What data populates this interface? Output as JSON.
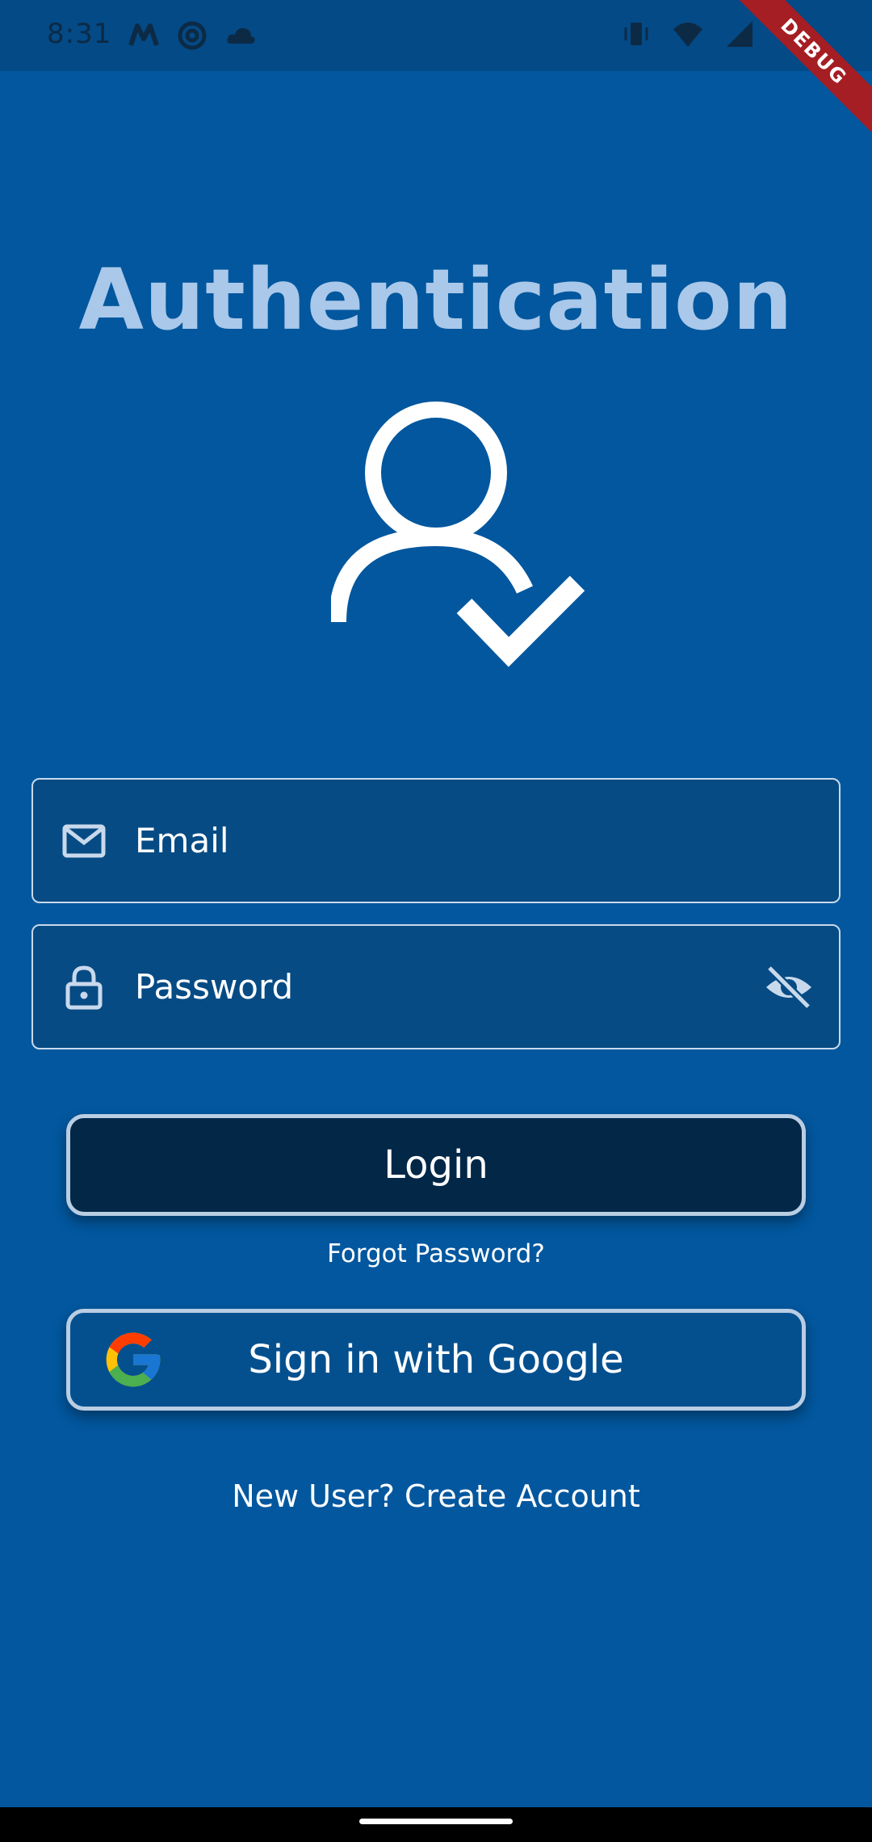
{
  "status_bar": {
    "time": "8:31",
    "left_icons": [
      "m-logo-icon",
      "at-sign-icon",
      "cloud-icon"
    ],
    "right_icons": [
      "vibrate-icon",
      "wifi-icon",
      "signal-icon",
      "battery-icon"
    ]
  },
  "debug_banner": {
    "label": "DEBUG"
  },
  "page": {
    "title": "Authentication",
    "hero_icon": "user-check-icon"
  },
  "form": {
    "email": {
      "placeholder": "Email",
      "value": "",
      "icon": "mail-icon"
    },
    "password": {
      "placeholder": "Password",
      "value": "",
      "icon": "lock-icon",
      "toggle_icon": "eye-off-icon"
    }
  },
  "actions": {
    "login_label": "Login",
    "forgot_label": "Forgot Password?",
    "google_label": "Sign in with Google",
    "create_account_label": "New User? Create Account"
  },
  "colors": {
    "background": "#02579e",
    "status_bar": "#034a86",
    "title": "#a9c8ea",
    "login_button": "#032747",
    "google_button": "#04508f",
    "field_background": "#064b84",
    "debug_ribbon": "#a51e24"
  }
}
